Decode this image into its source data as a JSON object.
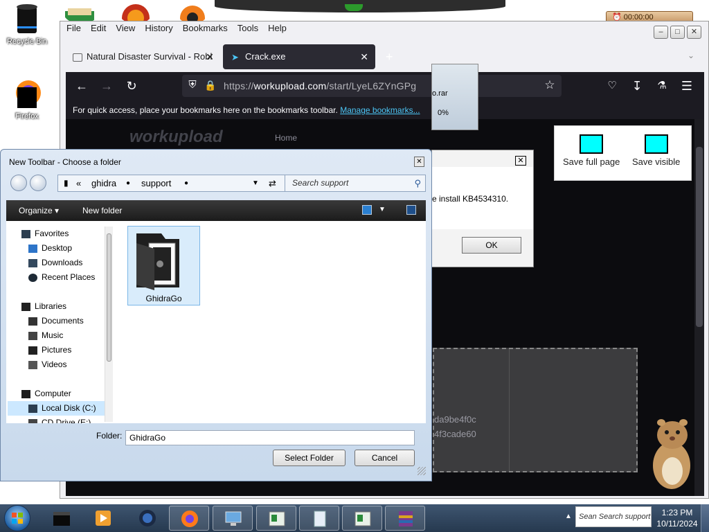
{
  "desktop": {
    "icons": [
      {
        "label": "Recycle Bin"
      },
      {
        "label": "Firefox"
      }
    ],
    "timer_text": "00:00:00"
  },
  "firefox": {
    "menu": [
      "File",
      "Edit",
      "View",
      "History",
      "Bookmarks",
      "Tools",
      "Help"
    ],
    "tabs": [
      {
        "title": "Natural Disaster Survival - Robl"
      },
      {
        "title": "Crack.exe"
      }
    ],
    "url_prefix": "https://",
    "url_domain": "workupload.com",
    "url_path": "/start/LyeL6ZYnGPg",
    "bookmarks_hint": "For quick access, place your bookmarks here on the bookmarks toolbar.",
    "bookmarks_link": "Manage bookmarks...",
    "site": {
      "logo": "workupload",
      "nav_home": "Home",
      "hash_line_1": "da9be4f0c",
      "hash_line_2": "4f3cade60"
    },
    "screenshot_panel": {
      "save_full_page": "Save full page",
      "save_visible": "Save visible"
    }
  },
  "winrar": {
    "file_fragment": "o.rar",
    "progress": "0%"
  },
  "message_box": {
    "text": "e install KB4534310.",
    "ok_label": "OK"
  },
  "folder_dialog": {
    "title": "New Toolbar - Choose a folder",
    "breadcrumb": [
      "ghidra",
      "support"
    ],
    "search_placeholder": "Search support",
    "commands": {
      "organize": "Organize",
      "new_folder": "New folder"
    },
    "tree": [
      {
        "label": "Favorites",
        "level": 0
      },
      {
        "label": "Desktop",
        "level": 1
      },
      {
        "label": "Downloads",
        "level": 1
      },
      {
        "label": "Recent Places",
        "level": 1
      },
      {
        "label": "Libraries",
        "level": 0
      },
      {
        "label": "Documents",
        "level": 1
      },
      {
        "label": "Music",
        "level": 1
      },
      {
        "label": "Pictures",
        "level": 1
      },
      {
        "label": "Videos",
        "level": 1
      },
      {
        "label": "Computer",
        "level": 0
      },
      {
        "label": "Local Disk (C:)",
        "level": 1,
        "selected": true
      },
      {
        "label": "CD Drive (E:)",
        "level": 1
      }
    ],
    "items": [
      {
        "name": "GhidraGo"
      }
    ],
    "folder_label": "Folder:",
    "folder_value": "GhidraGo",
    "select_button": "Select Folder",
    "cancel_button": "Cancel"
  },
  "taskbar": {
    "tray_search": "Sean Search support",
    "time": "1:23 PM",
    "date": "10/11/2024"
  }
}
